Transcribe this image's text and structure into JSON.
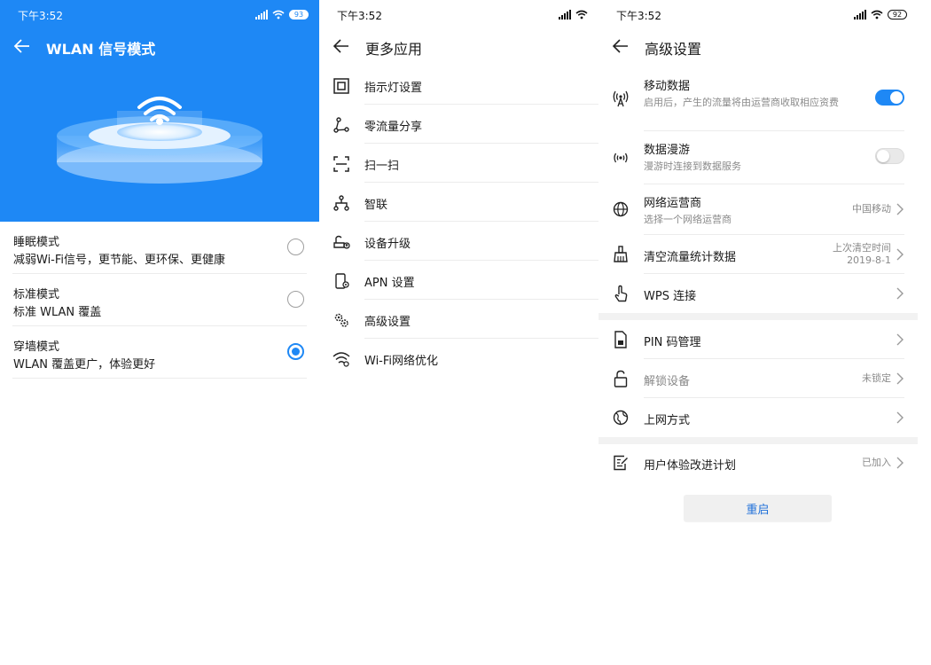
{
  "colors": {
    "accent": "#1e88f5",
    "divider": "#ececec",
    "secondary_text": "#8a8a8a"
  },
  "panel1": {
    "status": {
      "time": "下午3:52",
      "battery": "93"
    },
    "title": "WLAN 信号模式",
    "modes": [
      {
        "name": "睡眠模式",
        "desc": "减弱Wi-Fi信号，更节能、更环保、更健康",
        "selected": false
      },
      {
        "name": "标准模式",
        "desc": "标准 WLAN 覆盖",
        "selected": false
      },
      {
        "name": "穿墙模式",
        "desc": "WLAN 覆盖更广，体验更好",
        "selected": true
      }
    ]
  },
  "panel2": {
    "status": {
      "time": "下午3:52"
    },
    "title": "更多应用",
    "items": [
      {
        "label": "指示灯设置",
        "icon": "indicator-light-icon"
      },
      {
        "label": "零流量分享",
        "icon": "share-icon"
      },
      {
        "label": "扫一扫",
        "icon": "scan-icon"
      },
      {
        "label": "智联",
        "icon": "network-topology-icon"
      },
      {
        "label": "设备升级",
        "icon": "router-upgrade-icon"
      },
      {
        "label": "APN 设置",
        "icon": "apn-icon"
      },
      {
        "label": "高级设置",
        "icon": "gears-icon"
      },
      {
        "label": "Wi-Fi网络优化",
        "icon": "wifi-icon"
      }
    ]
  },
  "panel3": {
    "status": {
      "time": "下午3:52",
      "battery": "92"
    },
    "title": "高级设置",
    "mobile_data": {
      "title": "移动数据",
      "sub": "启用后，产生的流量将由运营商收取相应资费",
      "on": true
    },
    "roaming": {
      "title": "数据漫游",
      "sub": "漫游时连接到数据服务",
      "on": false
    },
    "carrier": {
      "title": "网络运营商",
      "sub": "选择一个网络运营商",
      "value": "中国移动"
    },
    "clear_stats": {
      "title": "清空流量统计数据",
      "value_line1": "上次清空时间",
      "value_line2": "2019-8-1"
    },
    "wps": {
      "title": "WPS 连接"
    },
    "pin": {
      "title": "PIN 码管理"
    },
    "unlock": {
      "title": "解锁设备",
      "value": "未锁定"
    },
    "internet": {
      "title": "上网方式"
    },
    "ux_plan": {
      "title": "用户体验改进计划",
      "value": "已加入"
    },
    "restart_label": "重启"
  }
}
